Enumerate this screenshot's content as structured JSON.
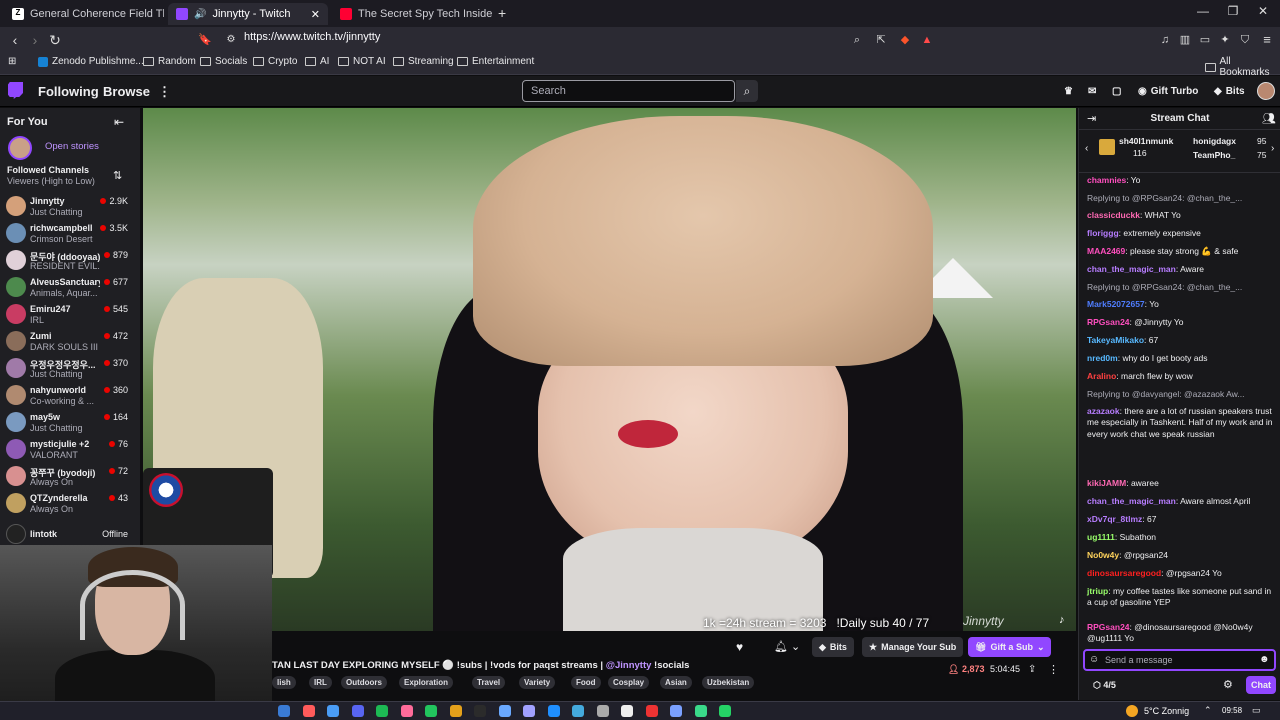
{
  "browser": {
    "tabs": [
      {
        "title": "General Coherence Field Theory (GC",
        "icon": "z-icon"
      },
      {
        "title": "Jinnytty - Twitch",
        "icon": "twitch-icon"
      },
      {
        "title": "The Secret Spy Tech Inside Every Cre",
        "icon": "youtube-icon"
      }
    ],
    "url": "https://www.twitch.tv/jinnytty",
    "bookmarks": [
      "Zenodo Publishme...",
      "Random",
      "Socials",
      "Crypto",
      "AI",
      "NOT AI",
      "Streaming",
      "Entertainment"
    ],
    "all_bookmarks": "All Bookmarks"
  },
  "twitch_nav": {
    "following": "Following",
    "browse": "Browse",
    "search_placeholder": "Search",
    "gift_turbo": "Gift Turbo",
    "bits": "Bits"
  },
  "sidebar": {
    "for_you": "For You",
    "open_stories": "Open stories",
    "followed_channels": "Followed Channels",
    "sort": "Viewers (High to Low)",
    "channels": [
      {
        "name": "Jinnytty",
        "game": "Just Chatting",
        "viewers": "2.9K",
        "color": "#d4a07a"
      },
      {
        "name": "richwcampbell",
        "game": "Crimson Desert",
        "viewers": "3.5K",
        "color": "#6b8fb5"
      },
      {
        "name": "문두야 (ddooyaa)",
        "game": "RESIDENT EVIL...",
        "viewers": "879",
        "color": "#e0d0d8"
      },
      {
        "name": "AlveusSanctuary",
        "game": "Animals, Aquar...",
        "viewers": "677",
        "color": "#4d8a4d"
      },
      {
        "name": "Emiru247",
        "game": "IRL",
        "viewers": "545",
        "color": "#c93c63"
      },
      {
        "name": "Zumi",
        "game": "DARK SOULS III",
        "viewers": "472",
        "color": "#8a6d5a"
      },
      {
        "name": "우정우정우정우...",
        "game": "Just Chatting",
        "viewers": "370",
        "color": "#a07aa8"
      },
      {
        "name": "nahyunworld",
        "game": "Co-working & ...",
        "viewers": "360",
        "color": "#b08a70"
      },
      {
        "name": "may5w",
        "game": "Just Chatting",
        "viewers": "164",
        "color": "#7a9ac0"
      },
      {
        "name": "mysticjulie +2",
        "game": "VALORANT",
        "viewers": "76",
        "color": "#8e5ab5"
      },
      {
        "name": "꽁쭈꾸 (byodoji)",
        "game": "Always On",
        "viewers": "72",
        "color": "#d89090"
      },
      {
        "name": "QTZynderella",
        "game": "Always On",
        "viewers": "43",
        "color": "#c0a060"
      }
    ],
    "offline_channel": {
      "name": "lintotk",
      "status": "Offline"
    }
  },
  "video": {
    "overlay": "1k =24h stream = 3203",
    "daily_sub": "!Daily sub 40 / 77",
    "watermark": "Jinnytty"
  },
  "stream_info": {
    "title": "TAN LAST DAY EXPLORING MYSELF ⚪ !subs | !vods for paqst streams |",
    "mention": "@Jinnytty",
    "socials": "!socials",
    "tags": [
      "lish",
      "IRL",
      "Outdoors",
      "Exploration",
      "Travel",
      "Variety",
      "Food",
      "Cosplay",
      "Asian",
      "Uzbekistan"
    ],
    "viewers": "2,873",
    "uptime": "5:04:45",
    "bits_label": "Bits",
    "manage_sub": "Manage Your Sub",
    "gift_sub": "Gift a Sub"
  },
  "chat": {
    "title": "Stream Chat",
    "leaderboard": [
      {
        "name": "sh40l1nmunk",
        "count": "116"
      },
      {
        "name": "honigdagx",
        "count": "95"
      },
      {
        "name": "TeamPho_",
        "count": "75"
      }
    ],
    "messages": [
      {
        "user": "chamnies",
        "text": ": Yo",
        "color": "#ff4fbf",
        "reply": ""
      },
      {
        "user": "",
        "text": "",
        "color": "#adadb8",
        "reply": "Replying to @RPGsan24: @chan_the_..."
      },
      {
        "user": "classicduckk",
        "text": ": WHAT Yo",
        "color": "#ff69b4",
        "reply": ""
      },
      {
        "user": "floriggg",
        "text": ": extremely expensive",
        "color": "#b77dff",
        "reply": ""
      },
      {
        "user": "MAA2469",
        "text": ": please stay strong 💪 & safe",
        "color": "#ff4fbf",
        "reply": ""
      },
      {
        "user": "chan_the_magic_man",
        "text": ": Aware",
        "color": "#b77dff",
        "reply": ""
      },
      {
        "user": "",
        "text": "",
        "color": "#adadb8",
        "reply": "Replying to @RPGsan24: @chan_the_..."
      },
      {
        "user": "Mark52072657",
        "text": ": Yo",
        "color": "#4f7dff",
        "reply": ""
      },
      {
        "user": "RPGsan24",
        "text": ": @Jinnytty Yo",
        "color": "#ff4fbf",
        "reply": ""
      },
      {
        "user": "TakeyaMikako",
        "text": ": 67",
        "color": "#58b9ff",
        "reply": ""
      },
      {
        "user": "nred0m",
        "text": ": why do I get booty ads",
        "color": "#58b9ff",
        "reply": ""
      },
      {
        "user": "Aralino",
        "text": ": march flew by wow",
        "color": "#ff4040",
        "reply": ""
      },
      {
        "user": "",
        "text": "",
        "color": "#adadb8",
        "reply": "Replying to @davyangel: @azazaok Aw..."
      },
      {
        "user": "azazaok",
        "text": ": there are a lot of russian speakers trust me especially in Tashkent. Half of my work and in every work chat we speak russian",
        "color": "#b77dff",
        "reply": ""
      },
      {
        "user": "kikiJAMM",
        "text": ": awaree",
        "color": "#ff69b4",
        "reply": ""
      },
      {
        "user": "chan_the_magic_man",
        "text": ": Aware almost April",
        "color": "#b77dff",
        "reply": ""
      },
      {
        "user": "xDv7qr_8tlmz",
        "text": ": 67",
        "color": "#b77dff",
        "reply": ""
      },
      {
        "user": "ug1111",
        "text": ": Subathon",
        "color": "#9aff6b",
        "reply": ""
      },
      {
        "user": "No0w4y",
        "text": ": @rpgsan24",
        "color": "#ffd35c",
        "reply": ""
      },
      {
        "user": "dinosaursaregood",
        "text": ": @rpgsan24 Yo",
        "color": "#ff2020",
        "reply": ""
      },
      {
        "user": "jtriup",
        "text": ": my coffee tastes like someone put sand in a cup of gasoline YEP",
        "color": "#9aff6b",
        "reply": ""
      },
      {
        "user": "RPGsan24",
        "text": ": @dinosaursaregood @No0w4y @ug1111 Yo",
        "color": "#ff4fbf",
        "reply": ""
      }
    ],
    "input_placeholder": "Send a message",
    "points": "4/5",
    "chat_button": "Chat"
  },
  "taskbar": {
    "weather": "5°C  Zonnig",
    "time": "09:58"
  }
}
